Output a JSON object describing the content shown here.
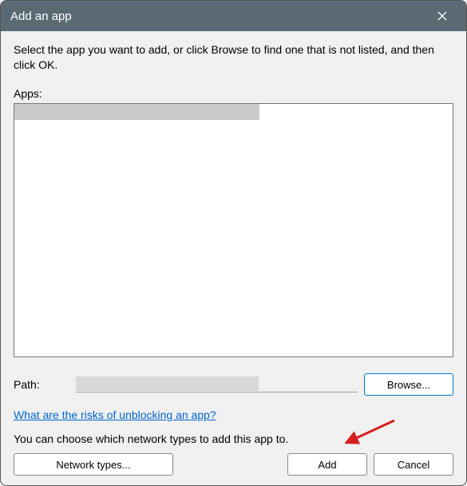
{
  "titlebar": {
    "title": "Add an app"
  },
  "intro": "Select the app you want to add, or click Browse to find one that is not listed, and then click OK.",
  "apps_label": "Apps:",
  "apps": {
    "selected_item": ""
  },
  "path": {
    "label": "Path:",
    "value": ""
  },
  "buttons": {
    "browse": "Browse...",
    "network_types": "Network types...",
    "add": "Add",
    "cancel": "Cancel"
  },
  "link": {
    "risks": "What are the risks of unblocking an app?"
  },
  "note": "You can choose which network types to add this app to."
}
